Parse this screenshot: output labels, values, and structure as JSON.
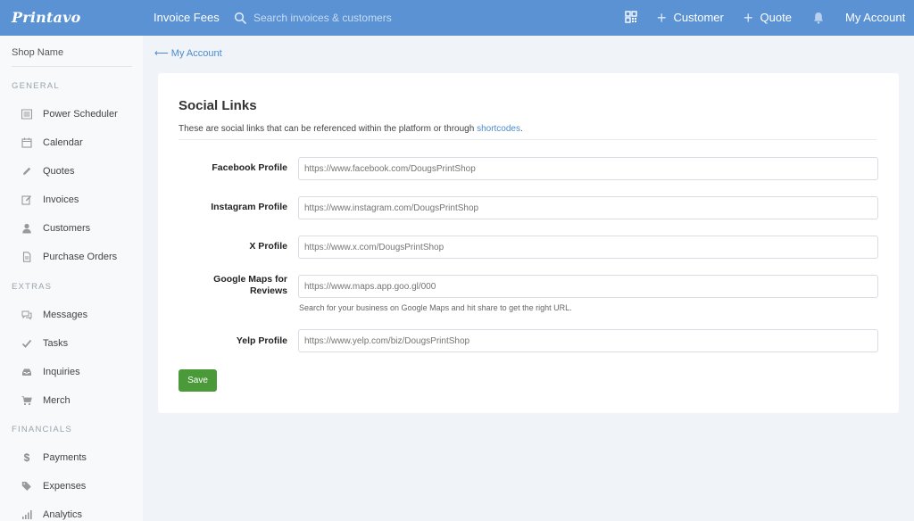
{
  "header": {
    "logo": "Printavo",
    "title": "Invoice Fees",
    "search_placeholder": "Search invoices & customers",
    "customer_label": "Customer",
    "quote_label": "Quote",
    "account_label": "My Account"
  },
  "sidebar": {
    "shop_name": "Shop Name",
    "sections": {
      "general": "GENERAL",
      "extras": "EXTRAS",
      "financials": "FINANCIALS"
    },
    "items": [
      {
        "label": "Power Scheduler",
        "icon": "list-icon"
      },
      {
        "label": "Calendar",
        "icon": "calendar-icon"
      },
      {
        "label": "Quotes",
        "icon": "pencil-icon"
      },
      {
        "label": "Invoices",
        "icon": "edit-icon"
      },
      {
        "label": "Customers",
        "icon": "person-icon"
      },
      {
        "label": "Purchase Orders",
        "icon": "document-icon"
      },
      {
        "label": "Messages",
        "icon": "chat-icon"
      },
      {
        "label": "Tasks",
        "icon": "check-icon"
      },
      {
        "label": "Inquiries",
        "icon": "inbox-icon"
      },
      {
        "label": "Merch",
        "icon": "cart-icon"
      },
      {
        "label": "Payments",
        "icon": "dollar-icon"
      },
      {
        "label": "Expenses",
        "icon": "tag-icon"
      },
      {
        "label": "Analytics",
        "icon": "bar-chart-icon"
      }
    ]
  },
  "breadcrumb": {
    "back_label": "My Account",
    "arrow": "⟵"
  },
  "card": {
    "title": "Social Links",
    "description": "These are social links that can be referenced within the platform or through ",
    "description_link": "shortcodes",
    "description_end": ".",
    "fields": {
      "facebook": {
        "label": "Facebook Profile",
        "placeholder": "https://www.facebook.com/DougsPrintShop"
      },
      "instagram": {
        "label": "Instagram Profile",
        "placeholder": "https://www.instagram.com/DougsPrintShop"
      },
      "x": {
        "label": "X Profile",
        "placeholder": "https://www.x.com/DougsPrintShop"
      },
      "google_maps": {
        "label": "Google Maps for Reviews",
        "placeholder": "https://www.maps.app.goo.gl/000",
        "help": "Search for your business on Google Maps and hit share to get the right URL."
      },
      "yelp": {
        "label": "Yelp Profile",
        "placeholder": "https://www.yelp.com/biz/DougsPrintShop"
      }
    },
    "save_label": "Save"
  },
  "colors": {
    "header_bg": "#5a92d4",
    "link": "#4a8cd0",
    "save_bg": "#4b9a3a"
  }
}
